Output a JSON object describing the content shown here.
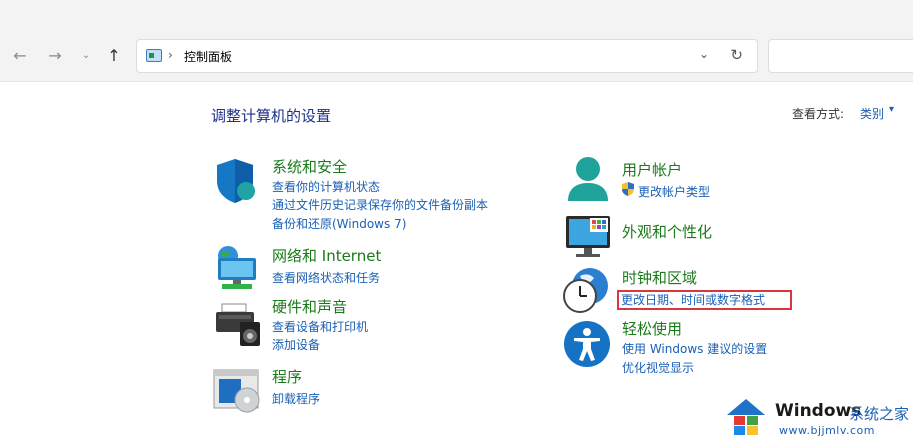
{
  "address_bar": {
    "breadcrumb": "控制面板"
  },
  "page": {
    "title": "调整计算机的设置",
    "view_by_label": "查看方式:",
    "view_by_value": "类别"
  },
  "categories": {
    "system_security": {
      "title": "系统和安全",
      "links": [
        "查看你的计算机状态",
        "通过文件历史记录保存你的文件备份副本",
        "备份和还原(Windows 7)"
      ]
    },
    "network": {
      "title": "网络和 Internet",
      "links": [
        "查看网络状态和任务"
      ]
    },
    "hardware": {
      "title": "硬件和声音",
      "links": [
        "查看设备和打印机",
        "添加设备"
      ]
    },
    "programs": {
      "title": "程序",
      "links": [
        "卸载程序"
      ]
    },
    "user_accounts": {
      "title": "用户帐户",
      "links": [
        "更改帐户类型"
      ]
    },
    "appearance": {
      "title": "外观和个性化",
      "links": []
    },
    "clock_region": {
      "title": "时钟和区域",
      "links": [
        "更改日期、时间或数字格式"
      ]
    },
    "ease_of_access": {
      "title": "轻松使用",
      "links": [
        "使用 Windows 建议的设置",
        "优化视觉显示"
      ]
    }
  },
  "watermark": {
    "brand": "Windows",
    "brand_cn": "系统之家",
    "url": "www.bjjmlv.com"
  },
  "colors": {
    "category_title": "#1a7a1a",
    "link": "#1a5fb4",
    "page_title": "#1e3287",
    "highlight_border": "#d9363e"
  }
}
